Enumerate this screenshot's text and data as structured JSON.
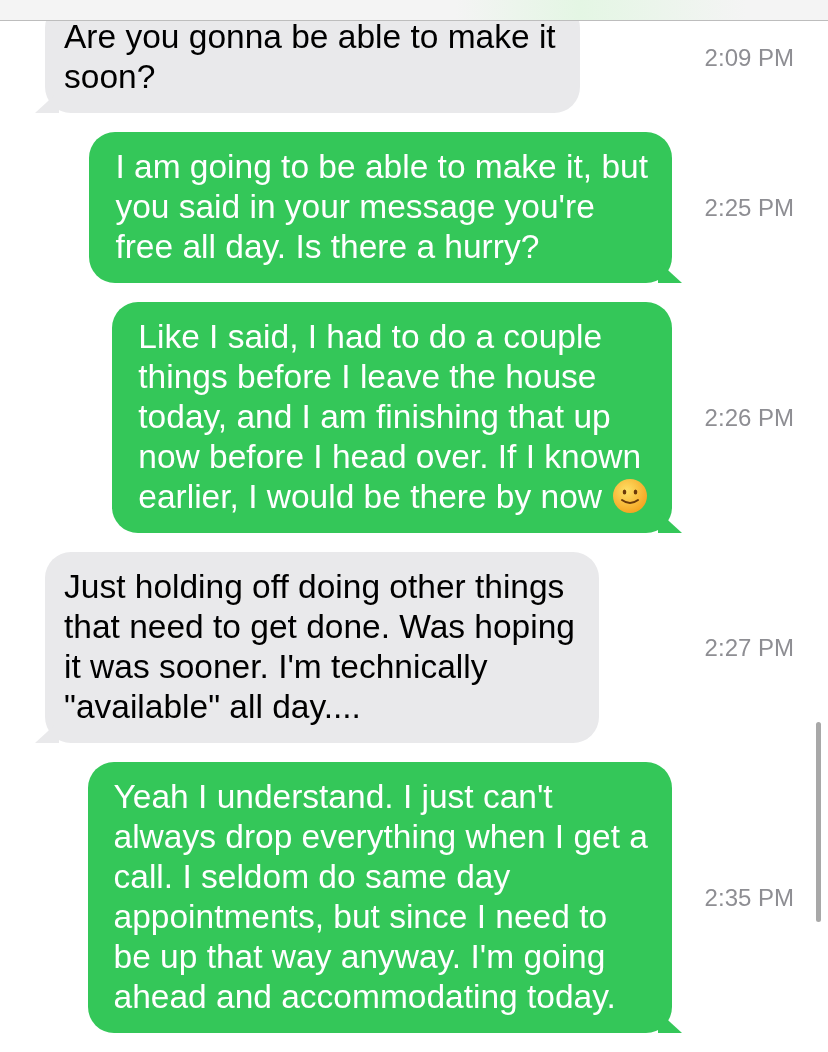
{
  "messages": [
    {
      "kind": "incoming",
      "text": "Are you gonna be able to make it\nsoon?",
      "time": "2:09 PM"
    },
    {
      "kind": "outgoing",
      "text": "I am going to be able to make it, but\nyou said in your message you're\nfree all day. Is there a hurry?",
      "time": "2:25 PM"
    },
    {
      "kind": "outgoing",
      "text": "Like I said, I had to do a couple\nthings before I leave the house\ntoday, and I am finishing that up\nnow before I head over. If I known\nearlier, I would be there by now",
      "smiley": true,
      "time": "2:26 PM"
    },
    {
      "kind": "incoming",
      "text": "Just holding off doing other things\nthat need to get done. Was hoping\nit was sooner. I'm technically\n\"available\" all day....",
      "time": "2:27 PM"
    },
    {
      "kind": "outgoing",
      "text": "Yeah I understand. I just can't\nalways drop everything when I get a\ncall. I seldom do same day\nappointments, but since I need to\nbe up that way anyway. I'm going\nahead and accommodating today.",
      "time": "2:35 PM"
    }
  ]
}
